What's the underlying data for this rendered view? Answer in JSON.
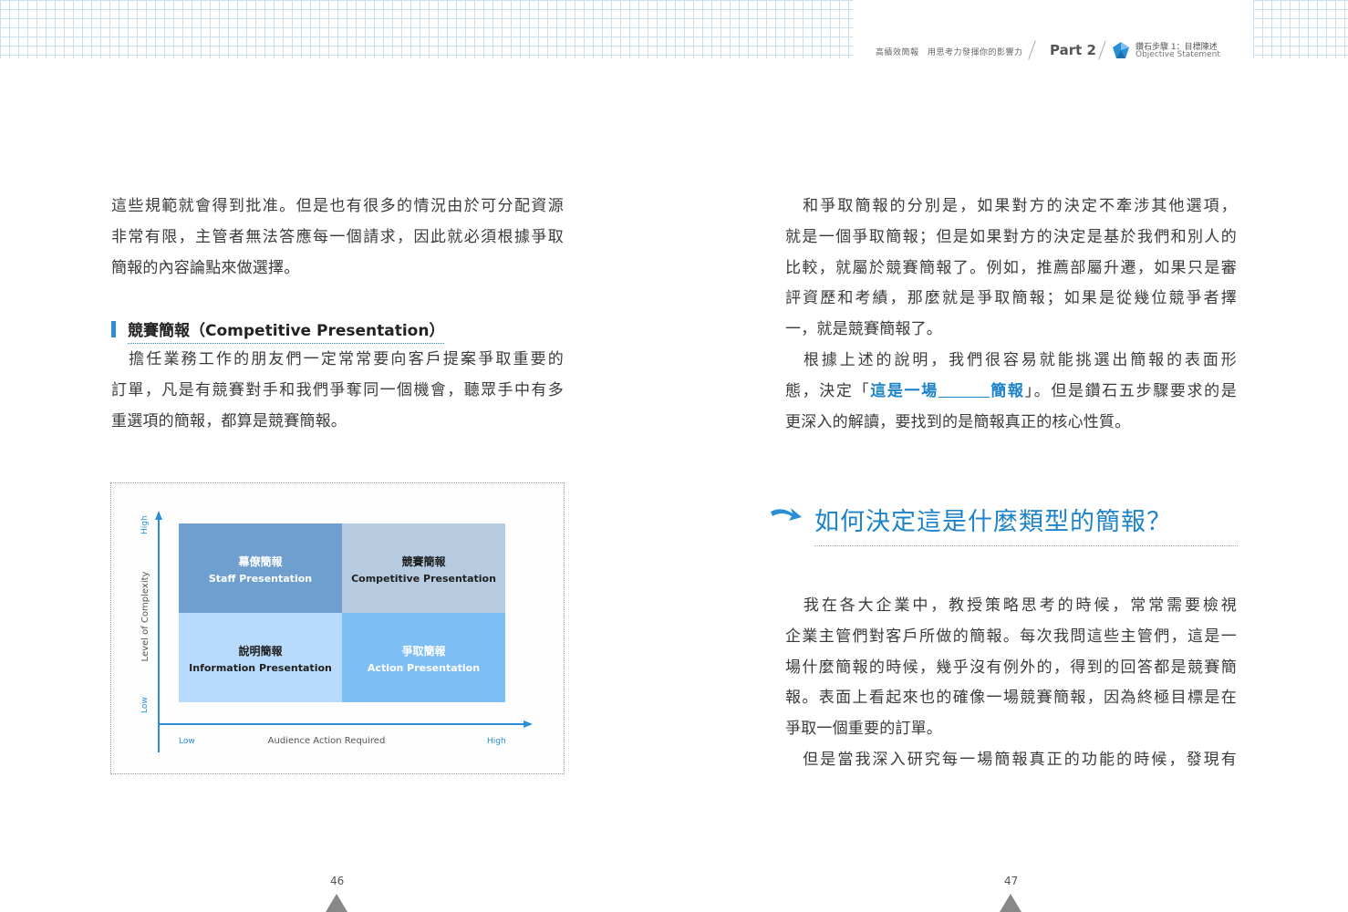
{
  "header": {
    "book_title": "高績效簡報　用思考力發揮你的影響力",
    "part": "Part 2",
    "step": "鑽石步驟 1：目標陳述",
    "step_en": "Objective Statement"
  },
  "left_page": {
    "para1_lines": [
      "這些規範就會得到批准。但是也有很多的情況由於可分配資源",
      "非常有限，主管者無法答應每一個請求，因此就必須根據爭取",
      "簡報的內容論點來做選擇。"
    ],
    "section_heading": "競賽簡報（Competitive Presentation）",
    "para2_lines": [
      "　擔任業務工作的朋友們一定常常要向客戶提案爭取重要的",
      "訂單，凡是有競賽對手和我們爭奪同一個機會，聽眾手中有多",
      "重選項的簡報，都算是競賽簡報。"
    ],
    "page_number": "46"
  },
  "chart_data": {
    "type": "matrix",
    "xlabel": "Audience Action Required",
    "ylabel": "Level of Complexity",
    "x_ticks": [
      "Low",
      "High"
    ],
    "y_ticks": [
      "Low",
      "High"
    ],
    "cells": [
      {
        "position": "top-left",
        "zh": "幕僚簡報",
        "en": "Staff Presentation",
        "color": "#6f9fce"
      },
      {
        "position": "top-right",
        "zh": "競賽簡報",
        "en": "Competitive Presentation",
        "color": "#b6cbe0"
      },
      {
        "position": "bottom-left",
        "zh": "說明簡報",
        "en": "Information Presentation",
        "color": "#b9dbfb"
      },
      {
        "position": "bottom-right",
        "zh": "爭取簡報",
        "en": "Action Presentation",
        "color": "#7dbef4"
      }
    ],
    "axis_color": "#2b8fd6"
  },
  "right_page": {
    "para1_lines": [
      "　和爭取簡報的分別是，如果對方的決定不牽涉其他選項，",
      "就是一個爭取簡報；但是如果對方的決定是基於我們和別人的",
      "比較，就屬於競賽簡報了。例如，推薦部屬升遷，如果只是審",
      "評資歷和考績，那麼就是爭取簡報；如果是從幾位競爭者擇",
      "一，就是競賽簡報了。",
      "　根據上述的說明，我們很容易就能挑選出簡報的表面形"
    ],
    "para1_line7_pre": "態，決定「",
    "para1_line7_hl1": "這是一場",
    "para1_line7_hl2": "簡報",
    "para1_line7_post": "」。但是鑽石五步驟要求的是",
    "para1_line8": "更深入的解讀，要找到的是簡報真正的核心性質。",
    "heading": "如何決定這是什麼類型的簡報？",
    "para2_lines": [
      "　我在各大企業中，教授策略思考的時候，常常需要檢視",
      "企業主管們對客戶所做的簡報。每次我問這些主管們，這是一",
      "場什麼簡報的時候，幾乎沒有例外的，得到的回答都是競賽簡",
      "報。表面上看起來也的確像一場競賽簡報，因為終極目標是在",
      "爭取一個重要的訂單。",
      "　但是當我深入研究每一場簡報真正的功能的時候，發現有"
    ],
    "page_number": "47"
  }
}
